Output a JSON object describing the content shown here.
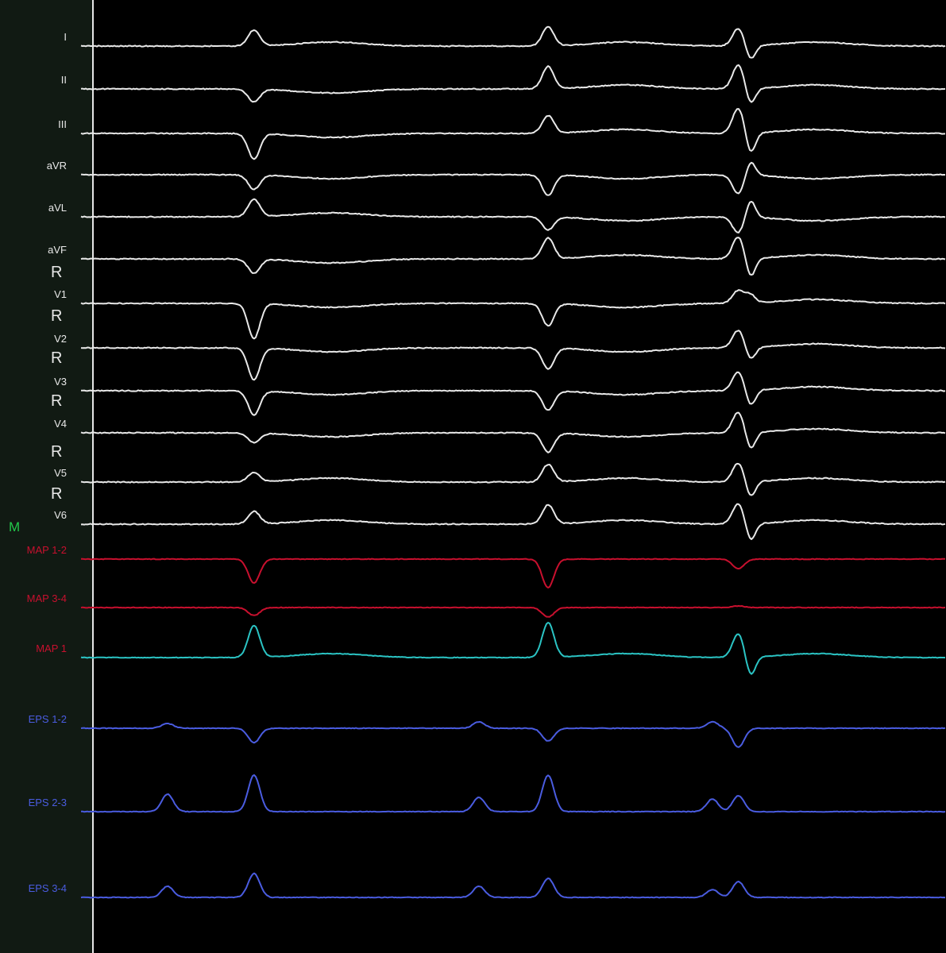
{
  "marker": {
    "text": "M",
    "color": "#22c84a"
  },
  "colors": {
    "background": "#000000",
    "sidebar": "#111a13",
    "ecg": "#e8e8e8",
    "map_bipolar": "#c8102e",
    "map_unipolar": "#2bc4c4",
    "eps": "#4a5ce0"
  },
  "chart_data": {
    "type": "line",
    "title": "",
    "xlabel": "",
    "ylabel": "",
    "grid": false,
    "legend": "channel labels at left of each trace",
    "x_range": [
      0,
      100
    ],
    "series": [
      {
        "name": "I",
        "color": "#e8e8e8",
        "beats": [
          [
            20,
            1.0
          ],
          [
            54,
            1.2
          ],
          [
            76,
            1.1,
            -0.9
          ]
        ]
      },
      {
        "name": "II",
        "color": "#e8e8e8",
        "beats": [
          [
            20,
            -0.8
          ],
          [
            54,
            1.4
          ],
          [
            76,
            1.5,
            -1.0
          ]
        ]
      },
      {
        "name": "III",
        "color": "#e8e8e8",
        "beats": [
          [
            20,
            -1.6
          ],
          [
            54,
            1.1
          ],
          [
            76,
            1.6,
            -1.3
          ]
        ]
      },
      {
        "name": "aVR",
        "color": "#e8e8e8",
        "beats": [
          [
            20,
            -0.9
          ],
          [
            54,
            -1.3
          ],
          [
            76,
            -1.2,
            0.9
          ]
        ]
      },
      {
        "name": "aVL",
        "color": "#e8e8e8",
        "beats": [
          [
            20,
            1.1
          ],
          [
            54,
            -0.8
          ],
          [
            76,
            -1.0,
            1.1
          ]
        ]
      },
      {
        "name": "aVF",
        "color": "#e8e8e8",
        "beats": [
          [
            20,
            -0.9
          ],
          [
            54,
            1.3
          ],
          [
            76,
            1.4,
            -1.2
          ]
        ]
      },
      {
        "name": "V1",
        "color": "#e8e8e8",
        "beats": [
          [
            20,
            -2.2
          ],
          [
            54,
            -1.4
          ],
          [
            76,
            0.8,
            0.5
          ]
        ]
      },
      {
        "name": "V2",
        "color": "#e8e8e8",
        "beats": [
          [
            20,
            -2.0
          ],
          [
            54,
            -1.3
          ],
          [
            76,
            1.1,
            -0.8
          ]
        ]
      },
      {
        "name": "V3",
        "color": "#e8e8e8",
        "beats": [
          [
            20,
            -1.5
          ],
          [
            54,
            -1.2
          ],
          [
            76,
            1.2,
            -1.0
          ]
        ]
      },
      {
        "name": "V4",
        "color": "#e8e8e8",
        "beats": [
          [
            20,
            -0.6
          ],
          [
            54,
            -1.2
          ],
          [
            76,
            1.3,
            -1.1
          ]
        ]
      },
      {
        "name": "V5",
        "color": "#e8e8e8",
        "beats": [
          [
            20,
            0.6
          ],
          [
            54,
            1.1
          ],
          [
            76,
            1.2,
            -1.0
          ]
        ]
      },
      {
        "name": "V6",
        "color": "#e8e8e8",
        "beats": [
          [
            20,
            0.8
          ],
          [
            54,
            1.2
          ],
          [
            76,
            1.3,
            -1.1
          ]
        ]
      },
      {
        "name": "MAP 1-2",
        "color": "#c8102e",
        "beats": [
          [
            20,
            -1.5
          ],
          [
            54,
            -1.8
          ],
          [
            76,
            -0.6
          ]
        ]
      },
      {
        "name": "MAP 3-4",
        "color": "#c8102e",
        "beats": [
          [
            20,
            -0.5
          ],
          [
            54,
            -0.6
          ],
          [
            76,
            0.1
          ]
        ]
      },
      {
        "name": "MAP 1",
        "color": "#2bc4c4",
        "beats": [
          [
            20,
            2.0
          ],
          [
            54,
            2.2
          ],
          [
            76,
            1.5,
            -1.2
          ]
        ]
      },
      {
        "name": "EPS 1-2",
        "color": "#4a5ce0",
        "beats": [
          [
            10,
            0.3
          ],
          [
            20,
            -0.9
          ],
          [
            46,
            0.4
          ],
          [
            54,
            -0.8
          ],
          [
            73,
            0.4
          ],
          [
            76,
            -1.2
          ]
        ]
      },
      {
        "name": "EPS 2-3",
        "color": "#4a5ce0",
        "beats": [
          [
            10,
            1.1
          ],
          [
            20,
            2.3
          ],
          [
            46,
            0.9
          ],
          [
            54,
            2.3
          ],
          [
            73,
            0.8
          ],
          [
            76,
            1.0
          ]
        ]
      },
      {
        "name": "EPS 3-4",
        "color": "#4a5ce0",
        "beats": [
          [
            10,
            0.7
          ],
          [
            20,
            1.5
          ],
          [
            46,
            0.7
          ],
          [
            54,
            1.2
          ],
          [
            73,
            0.5
          ],
          [
            76,
            1.0
          ]
        ]
      }
    ]
  },
  "row_labels": [
    {
      "text": "R",
      "color": "#e8e8e8"
    },
    {
      "text": "R",
      "color": "#e8e8e8"
    },
    {
      "text": "R",
      "color": "#e8e8e8"
    },
    {
      "text": "R",
      "color": "#e8e8e8"
    },
    {
      "text": "R",
      "color": "#e8e8e8"
    },
    {
      "text": "R",
      "color": "#e8e8e8"
    }
  ]
}
